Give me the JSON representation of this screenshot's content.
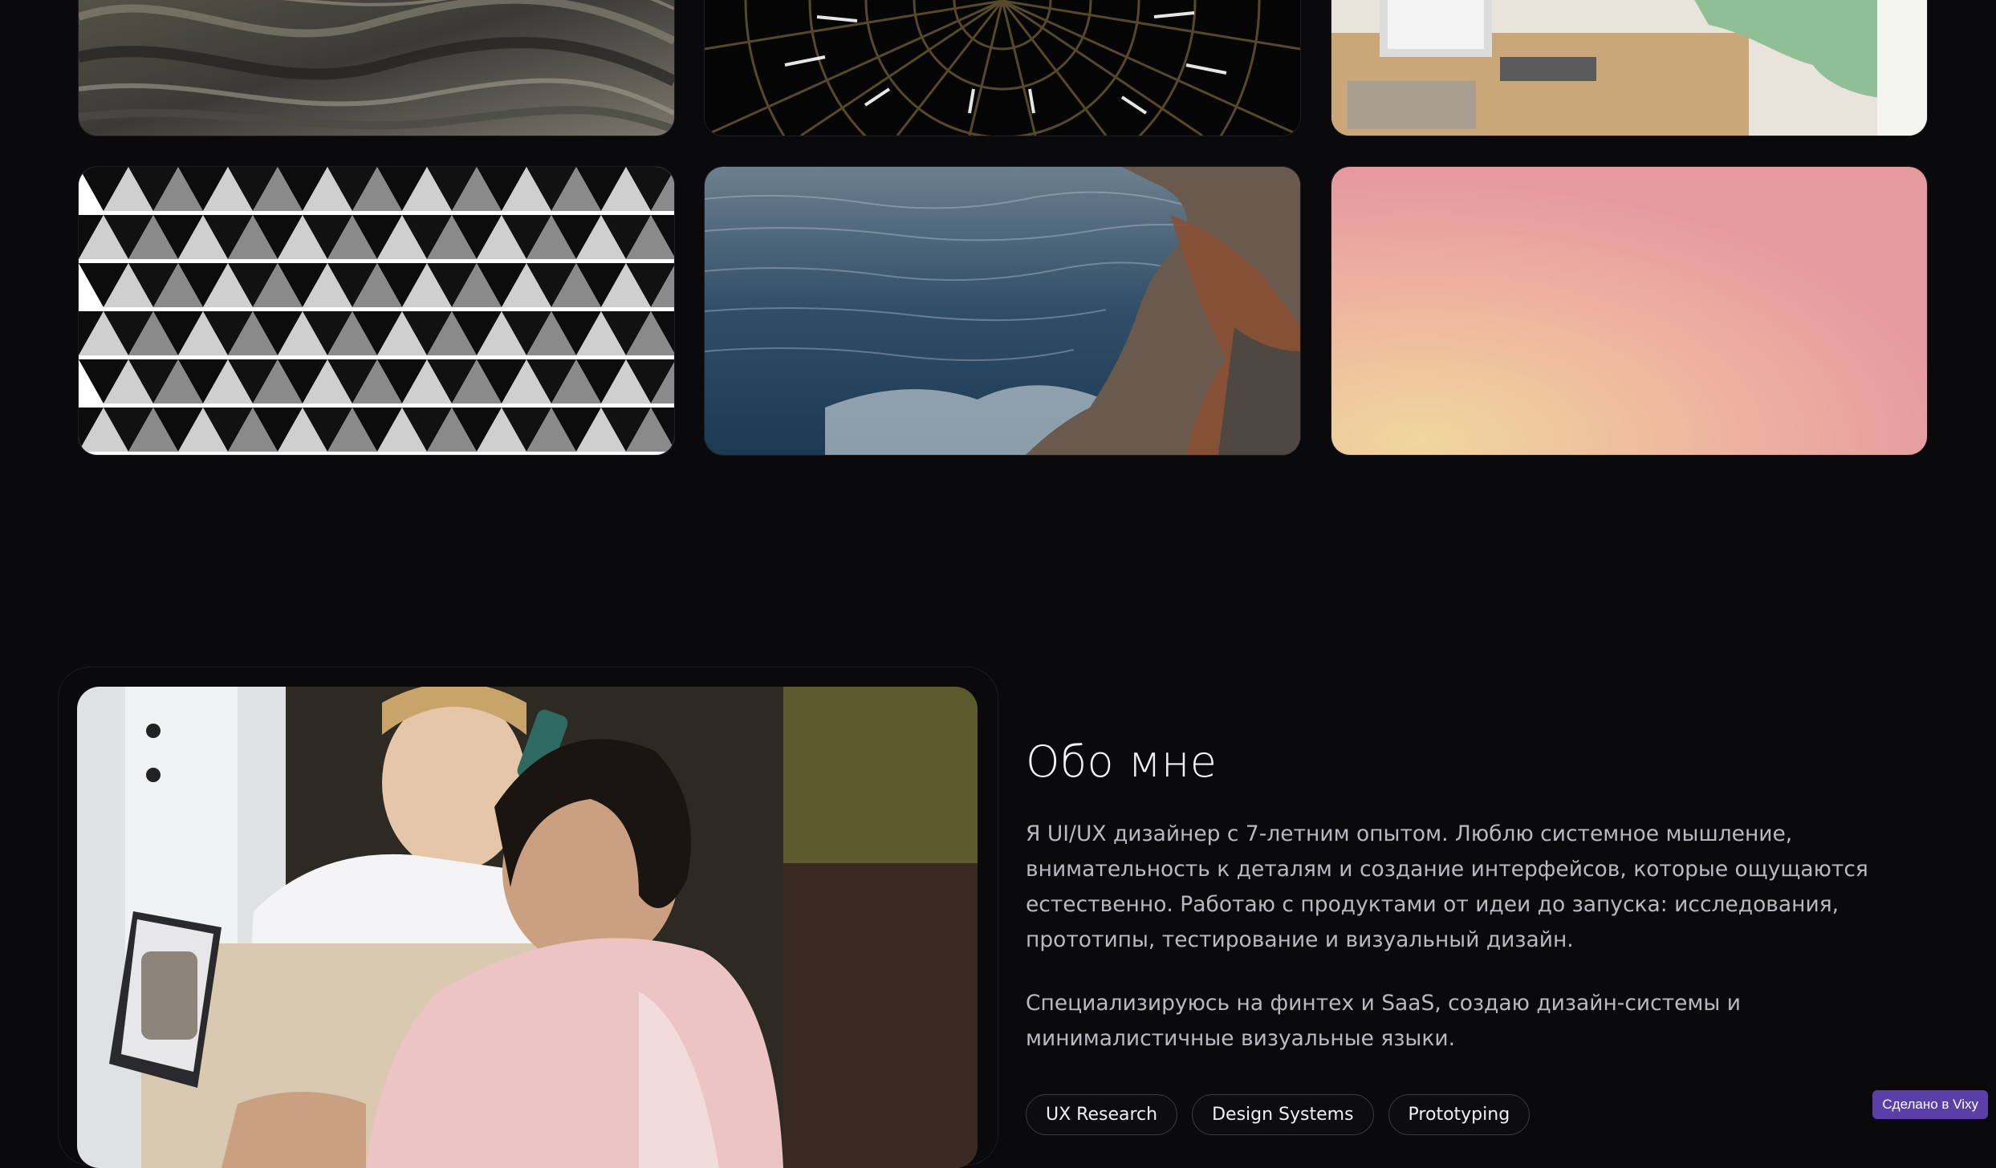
{
  "gallery": {
    "images": [
      {
        "name": "marble-texture-image"
      },
      {
        "name": "dome-lights-image"
      },
      {
        "name": "workspace-desk-image"
      },
      {
        "name": "geometric-pattern-image"
      },
      {
        "name": "ocean-cliff-image"
      },
      {
        "name": "pink-gradient-image"
      }
    ]
  },
  "about": {
    "title": "Обо мне",
    "paragraph1": "Я UI/UX дизайнер с 7-летним опытом. Люблю системное мышление, внимательность к деталям и создание интерфейсов, которые ощущаются естественно. Работаю с продуктами от идеи до запуска: исследования, прототипы, тестирование и визуальный дизайн.",
    "paragraph2": "Специализируюсь на финтех и SaaS, создаю дизайн-системы и минималистичные визуальные языки.",
    "tags": [
      "UX Research",
      "Design Systems",
      "Prototyping"
    ]
  },
  "badge": {
    "label": "Сделано в Vixy",
    "color": "#5b3fa8"
  },
  "colors": {
    "background": "#0a0a0c",
    "text_primary": "#f2f2f4",
    "text_secondary": "#b9b9c0"
  }
}
